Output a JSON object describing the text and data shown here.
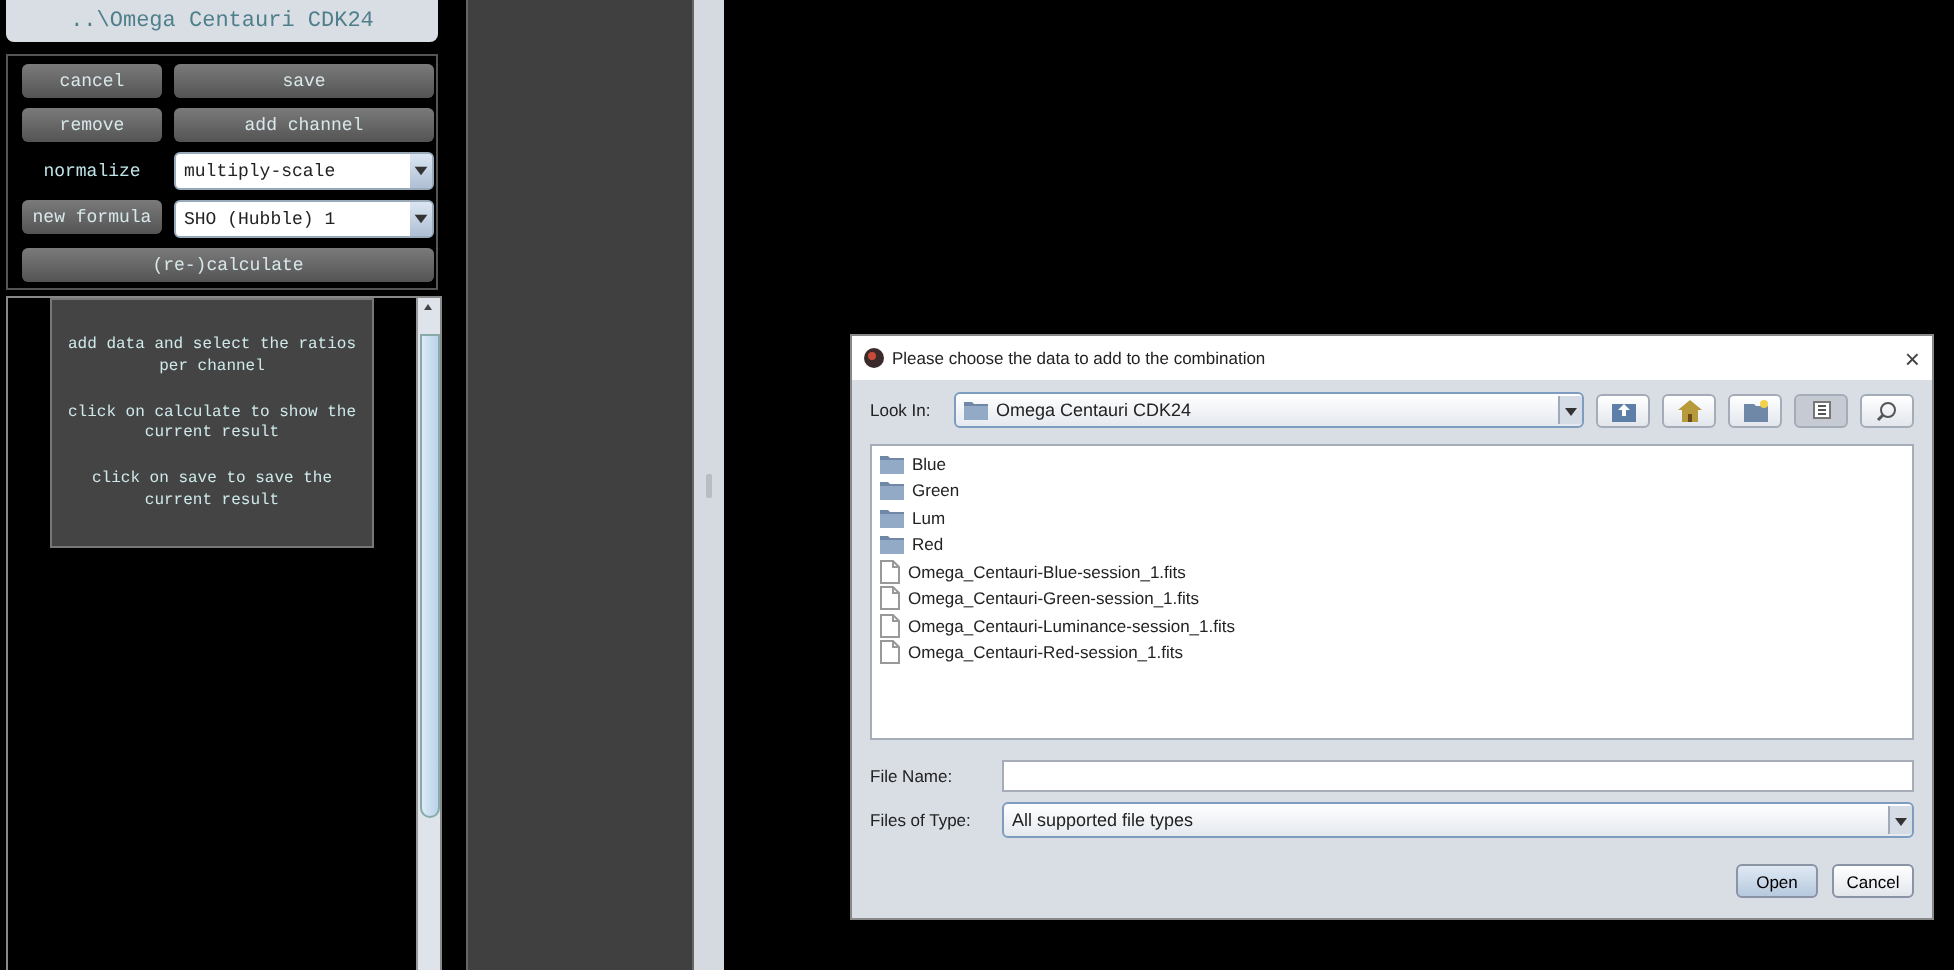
{
  "panel": {
    "title": "..\\Omega Centauri CDK24",
    "controls": [
      {
        "kind": "button",
        "label": "cancel"
      },
      {
        "kind": "button",
        "label": "save"
      },
      {
        "kind": "button",
        "label": "remove"
      },
      {
        "kind": "button",
        "label": "add channel"
      },
      {
        "kind": "label",
        "label": "normalize"
      },
      {
        "kind": "select",
        "label": "multiply-scale"
      },
      {
        "kind": "button",
        "label": "new formula"
      },
      {
        "kind": "select",
        "label": "SHO (Hubble) 1"
      },
      {
        "kind": "button",
        "label": "(re-)calculate"
      }
    ],
    "info": [
      "add data and select the ratios per channel",
      "click on calculate to show the current result",
      "click on save to save the current result"
    ]
  },
  "dialog": {
    "title": "Please choose the data to add to the combination",
    "close": "×",
    "look_in": {
      "label": "Look In:",
      "value": "Omega Centauri CDK24"
    },
    "toolbar": [
      {
        "selected": false
      },
      {
        "selected": false
      },
      {
        "selected": false
      },
      {
        "selected": true
      },
      {
        "selected": false
      }
    ],
    "files": [
      {
        "kind": "folder",
        "name": "Blue"
      },
      {
        "kind": "folder",
        "name": "Green"
      },
      {
        "kind": "folder",
        "name": "Lum"
      },
      {
        "kind": "folder",
        "name": "Red"
      },
      {
        "kind": "file",
        "name": "Omega_Centauri-Blue-session_1.fits"
      },
      {
        "kind": "file",
        "name": "Omega_Centauri-Green-session_1.fits"
      },
      {
        "kind": "file",
        "name": "Omega_Centauri-Luminance-session_1.fits"
      },
      {
        "kind": "file",
        "name": "Omega_Centauri-Red-session_1.fits"
      }
    ],
    "file_name": {
      "label": "File Name:"
    },
    "file_type": {
      "label": "Files of Type:",
      "value": "All supported file types"
    },
    "buttons": [
      {
        "label": "Open",
        "default": true
      },
      {
        "label": "Cancel",
        "default": false
      }
    ]
  }
}
